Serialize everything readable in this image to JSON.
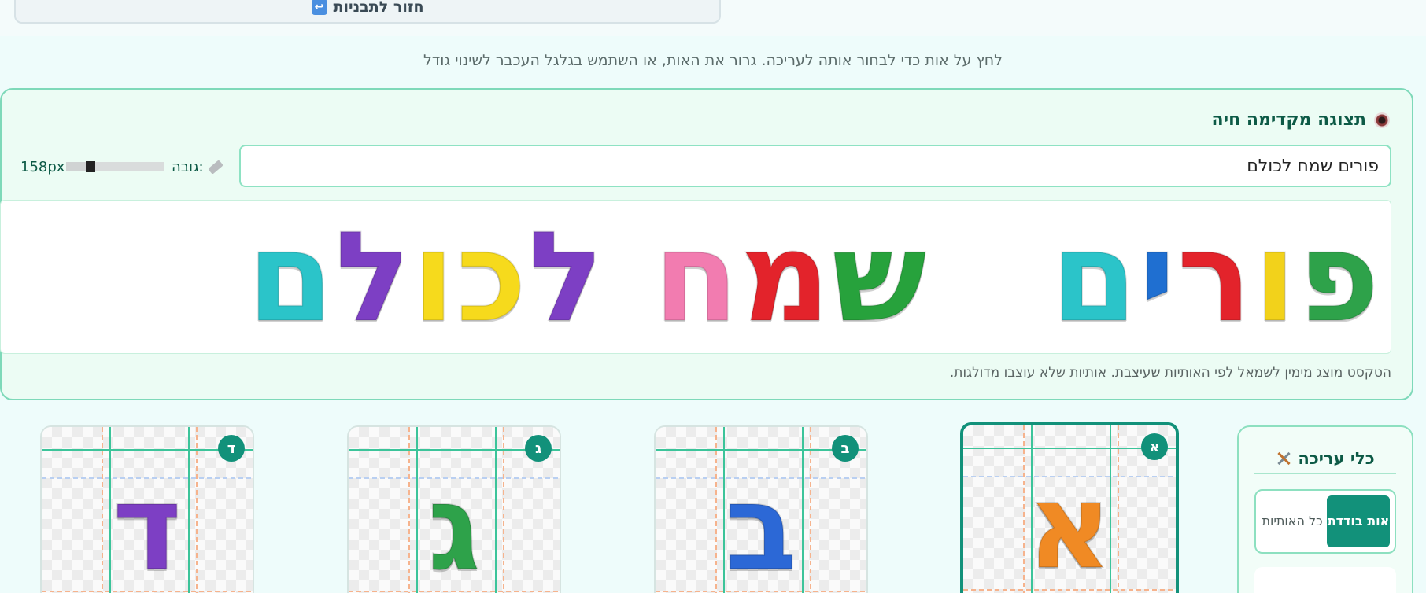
{
  "header": {
    "back_button_label": "חזור לתבניות",
    "back_icon": "back-arrow-icon"
  },
  "hint": "לחץ על אות כדי לבחור אותה לעריכה. גרור את האות, או השתמש בגלגל העכבר לשינוי גודל",
  "preview": {
    "title": "תצוגה מקדימה חיה",
    "title_icon": "eye-icon",
    "text_value": "פורים שמח לכולם",
    "height_label": "גובה:",
    "height_icon": "ruler-icon",
    "height_value": "158px",
    "height_level": 0.25,
    "note": "הטקסט מוצג מימין לשמאל לפי האותיות שעיצבת. אותיות שלא עוצבו מדולגות.",
    "words": [
      {
        "letters": [
          {
            "ch": "פ",
            "color": "#2ea24a"
          },
          {
            "ch": "ו",
            "color": "#f2d21b"
          },
          {
            "ch": "ר",
            "color": "#e3232b"
          },
          {
            "ch": "י",
            "color": "#1f6fd1"
          },
          {
            "ch": "ם",
            "color": "#2bc4c9"
          }
        ]
      },
      {
        "letters": [
          {
            "ch": "ש",
            "color": "#27a23c"
          },
          {
            "ch": "מ",
            "color": "#e3232b"
          },
          {
            "ch": "ח",
            "color": "#f27cb0"
          }
        ]
      },
      {
        "letters": [
          {
            "ch": "ל",
            "color": "#7d3fc4"
          },
          {
            "ch": "כ",
            "color": "#f6da1c"
          },
          {
            "ch": "ו",
            "color": "#f6da1c"
          },
          {
            "ch": "ל",
            "color": "#7d3fc4"
          },
          {
            "ch": "ם",
            "color": "#2bc4c9"
          }
        ]
      }
    ]
  },
  "tools": {
    "title": "כלי עריכה",
    "title_icon": "tools-icon",
    "mode_single": "אות בודדת",
    "mode_all": "כל האותיות",
    "active_mode": "single"
  },
  "cards": [
    {
      "badge": "א",
      "letter": "א",
      "color": "#f08a24",
      "selected": true
    },
    {
      "badge": "ב",
      "letter": "ב",
      "color": "#2c68d6",
      "selected": false
    },
    {
      "badge": "ג",
      "letter": "ג",
      "color": "#2ea24a",
      "selected": false
    },
    {
      "badge": "ד",
      "letter": "ד",
      "color": "#7d3fc4",
      "selected": false
    }
  ]
}
